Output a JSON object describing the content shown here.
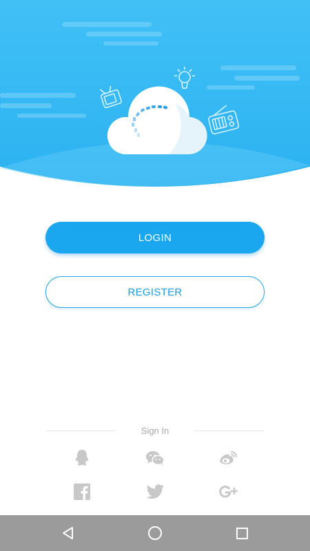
{
  "auth": {
    "login_label": "LOGIN",
    "register_label": "REGISTER"
  },
  "social_login": {
    "title": "Sign In",
    "providers": [
      "qq-icon",
      "wechat-icon",
      "weibo-icon",
      "facebook-icon",
      "twitter-icon",
      "google-plus-icon"
    ]
  },
  "nav_bar": {
    "buttons": [
      "back-triangle-icon",
      "home-circle-icon",
      "recents-square-icon"
    ]
  },
  "colors": {
    "sky": "#3cbcf5",
    "accent": "#1aa7ef",
    "social_icon": "#c8c8c8",
    "nav_bar": "#9b9b9b"
  }
}
